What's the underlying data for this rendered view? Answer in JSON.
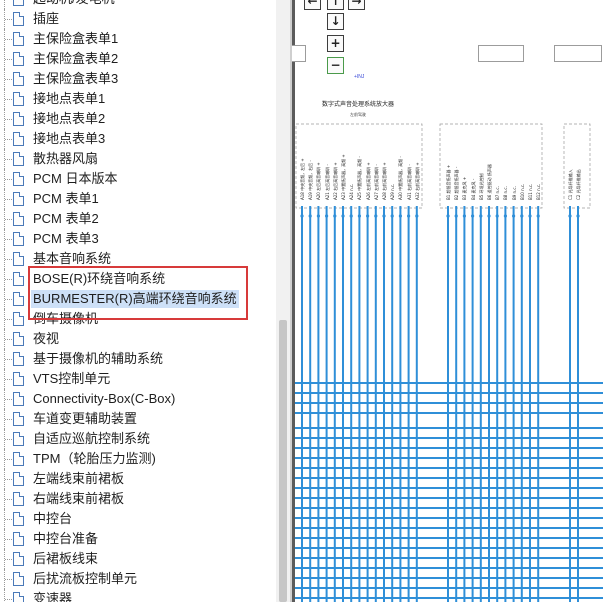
{
  "tree": {
    "items": [
      {
        "label": "起动机/发电机"
      },
      {
        "label": "插座"
      },
      {
        "label": "主保险盒表单1"
      },
      {
        "label": "主保险盒表单2"
      },
      {
        "label": "主保险盒表单3"
      },
      {
        "label": "接地点表单1"
      },
      {
        "label": "接地点表单2"
      },
      {
        "label": "接地点表单3"
      },
      {
        "label": "散热器风扇"
      },
      {
        "label": "PCM 日本版本"
      },
      {
        "label": "PCM 表单1"
      },
      {
        "label": "PCM 表单2"
      },
      {
        "label": "PCM 表单3"
      },
      {
        "label": "基本音响系统"
      },
      {
        "label": "BOSE(R)环绕音响系统"
      },
      {
        "label": "BURMESTER(R)高端环绕音响系统"
      },
      {
        "label": "倒车摄像机"
      },
      {
        "label": "夜视"
      },
      {
        "label": "基于摄像机的辅助系统"
      },
      {
        "label": "VTS控制单元"
      },
      {
        "label": "Connectivity-Box(C-Box)"
      },
      {
        "label": "车道变更辅助装置"
      },
      {
        "label": "自适应巡航控制系统"
      },
      {
        "label": "TPM（轮胎压力监测)"
      },
      {
        "label": "左端线束前裙板"
      },
      {
        "label": "右端线束前裙板"
      },
      {
        "label": "中控台"
      },
      {
        "label": "中控台准备"
      },
      {
        "label": "后裙板线束"
      },
      {
        "label": "后扰流板控制单元"
      },
      {
        "label": "变速器"
      }
    ],
    "selected_index": 15
  },
  "diagram": {
    "controls": {
      "arrow_left": "←",
      "arrow_up": "↑",
      "arrow_right": "→",
      "arrow_down": "↓",
      "zoom_in": "+",
      "zoom_out": "−"
    },
    "inj_label": "+INJ",
    "title": "数字式声音处理系统放大器",
    "subtitle": "左前驾驶",
    "pins": [
      "A18 中央音频，左后 +",
      "A19 中央音频，右后 -",
      "A20 左后高音喇叭 +",
      "A21 左后高音喇叭 -",
      "A22 右后高音喇叭 +",
      "A23 中置扬声器，高频 +",
      "A24 n.c.",
      "A25 中置扬声器，高频 -",
      "A26 左前高音喇叭 +",
      "A27 左前高音喇叭 -",
      "A28 右前高音喇叭 +",
      "A29 n.c.",
      "A30 中置扬声器，高频 -",
      "A31 右前高音喇叭 -",
      "A32 右前高音喇叭 +",
      "B1 超低音扬声器 +",
      "B2 超低音扬声器 -",
      "B3 麦克风 +",
      "B4 麦克风 -",
      "B5 环境光控制",
      "B6 遥控驱动 扬声器",
      "B7 n.c.",
      "B8 n.c.",
      "B9 n.c.",
      "B10 n.c.",
      "B11 n.c.",
      "B12 n.c.",
      "C1 光导纤维输入",
      "C2 光导纤维输出"
    ]
  }
}
